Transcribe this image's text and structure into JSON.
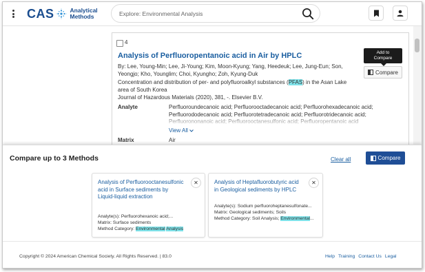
{
  "header": {
    "logo_text": "CAS",
    "logo_subtitle_line1": "Analytical",
    "logo_subtitle_line2": "Methods",
    "search_placeholder": "Explore: Environmental Analysis"
  },
  "result": {
    "number": "4",
    "title": "Analysis of Perfluoropentanoic acid in Air by HPLC",
    "authors": "By: Lee, Young-Min; Lee, Ji-Young; Kim, Moon-Kyung; Yang, Heedeuk; Lee, Jung-Eun; Son, Yeongjo; Kho, Younglim; Choi, Kyungho; Zoh, Kyung-Duk",
    "paper_title_before": "Concentration and distribution of per- and polyfluoroalkyl substances (",
    "paper_title_highlight": "PFAS",
    "paper_title_after": ") in the Asan Lake area of South Korea",
    "journal": "Journal of Hazardous Materials (2020), 381, -. Elsevier B.V.",
    "analyte_label": "Analyte",
    "analyte_values": "Perfluoroundecanoic acid; Perfluorooctadecanoic acid; Perfluorohexadecanoic acid; Perfluorododecanoic acid; Perfluorotetradecanoic acid; Perfluorotridecanoic acid; Perfluorononanoic acid; Perfluorooctanesulfonic acid; Perfluoropentanoic acid",
    "view_all": "View All",
    "matrix_label": "Matrix",
    "matrix_value": "Air",
    "tooltip_line1": "Add to",
    "tooltip_line2": "Compare",
    "compare_button": "Compare"
  },
  "compare_panel": {
    "heading": "Compare up to 3 Methods",
    "clear_all": "Clear all",
    "compare_button": "Compare",
    "cards": [
      {
        "title": "Analysis of Perfluorooctanesulfonic acid in Surface sediments by Liquid-liquid extraction",
        "analytes": "Analyte(s):  Perfluorohexanoic acid;...",
        "matrix": "Matrix:  Surface sediments",
        "category_label": "Method Category:  ",
        "category_highlight": "Environmental",
        "category_gap": " ",
        "category_highlight2": "Analysis",
        "category_after": ""
      },
      {
        "title": "Analysis of Heptafluorobutyric acid in Geological sediments by HPLC",
        "analytes": "Analyte(s):  Sodium perfluoroheptanesulfonate...",
        "matrix": "Matrix:  Geological sediments; Soils",
        "category_label": "Method Category:  Soil Analysis; ",
        "category_highlight": "Environmental",
        "category_gap": "",
        "category_highlight2": "",
        "category_after": "..."
      }
    ]
  },
  "footer": {
    "copyright": "Copyright © 2024 American Chemical Society. All Rights Reserved.  |  83.0",
    "links": [
      "Help",
      "Training",
      "Contact Us",
      "Legal"
    ]
  },
  "colors": {
    "brand_blue": "#1a4d8f",
    "link_blue": "#1a5ea0",
    "compare_button": "#1f4e96",
    "highlight": "#7fe3ea"
  },
  "icons": [
    "more-vertical-icon",
    "cas-logo-icon",
    "search-icon",
    "bookmark-icon",
    "user-icon",
    "compare-icon",
    "chevron-down-icon",
    "close-icon"
  ]
}
